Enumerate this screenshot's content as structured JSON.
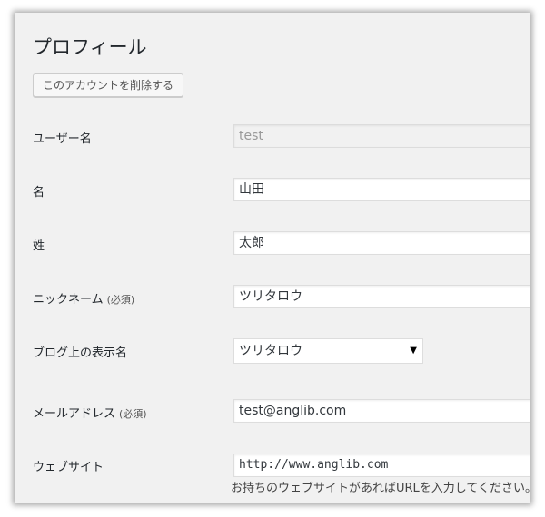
{
  "page": {
    "title": "プロフィール",
    "delete_button": "このアカウントを削除する"
  },
  "fields": {
    "username": {
      "label": "ユーザー名",
      "value": "test"
    },
    "first_name": {
      "label": "名",
      "value": "山田"
    },
    "last_name": {
      "label": "姓",
      "value": "太郎"
    },
    "nickname": {
      "label": "ニックネーム",
      "required": "(必須)",
      "value": "ツリタロウ"
    },
    "display_name": {
      "label": "ブログ上の表示名",
      "value": "ツリタロウ"
    },
    "email": {
      "label": "メールアドレス",
      "required": "(必須)",
      "value": "test@anglib.com"
    },
    "website": {
      "label": "ウェブサイト",
      "value": "http://www.anglib.com",
      "description": "お持ちのウェブサイトがあればURLを入力してください。"
    }
  }
}
